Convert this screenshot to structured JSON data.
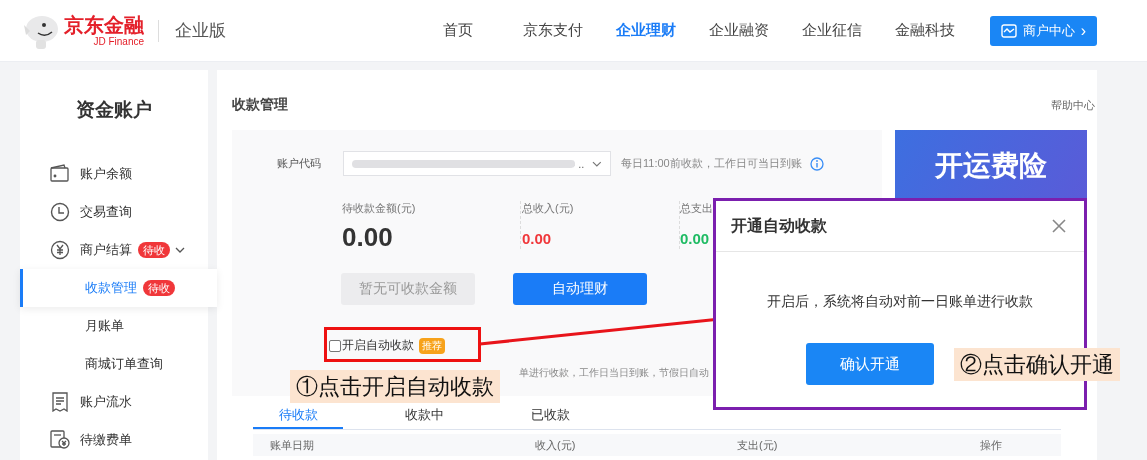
{
  "header": {
    "logo": {
      "name": "京东金融",
      "subtitle": "JD Finance"
    },
    "edition": "企业版",
    "nav": [
      {
        "label": "首页",
        "selected": false
      },
      {
        "label": "京东支付",
        "selected": false
      },
      {
        "label": "企业理财",
        "selected": true
      },
      {
        "label": "企业融资",
        "selected": false
      },
      {
        "label": "企业征信",
        "selected": false
      },
      {
        "label": "金融科技",
        "selected": false
      }
    ],
    "merchant_button": {
      "label": "商户中心",
      "arrow": "›"
    }
  },
  "sidebar": {
    "title": "资金账户",
    "items": [
      {
        "label": "账户余额",
        "kind": "wallet",
        "selected": false
      },
      {
        "label": "交易查询",
        "kind": "clock",
        "selected": false
      },
      {
        "label": "商户结算",
        "kind": "yen",
        "badge": "待收",
        "expanded": true,
        "selected": false,
        "children": [
          {
            "label": "收款管理",
            "badge": "待收",
            "selected": true
          },
          {
            "label": "月账单",
            "selected": false
          },
          {
            "label": "商城订单查询",
            "selected": false
          }
        ]
      },
      {
        "label": "账户流水",
        "kind": "receipt",
        "selected": false
      },
      {
        "label": "待缴费单",
        "kind": "bill",
        "selected": false
      }
    ]
  },
  "content": {
    "title": "收款管理",
    "help_link": "帮助中心",
    "account": {
      "label": "账户代码",
      "value": "..",
      "hint": "每日11:00前收款，工作日可当日到账"
    },
    "stats": [
      {
        "label": "待收款金额(元)",
        "value": "0.00",
        "kind": "pending"
      },
      {
        "label": "总收入(元)",
        "value": "0.00",
        "kind": "income"
      },
      {
        "label": "总支出",
        "value": "0.00",
        "kind": "expense"
      }
    ],
    "buttons": [
      {
        "label": "暂无可收款金额",
        "disabled": true
      },
      {
        "label": "自动理财",
        "disabled": false
      }
    ],
    "auto_collect": {
      "label": "开启自动收款",
      "checked": false,
      "badge": "推荐"
    },
    "auto_hint": "单进行收款，工作日当日到账，节假日自动",
    "banner": {
      "text": "开运费险"
    },
    "tabs": [
      {
        "label": "待收款",
        "selected": true
      },
      {
        "label": "收款中",
        "selected": false
      },
      {
        "label": "已收款",
        "selected": false
      }
    ],
    "table": {
      "columns": [
        "账单日期",
        "收入(元)",
        "支出(元)",
        "操作"
      ]
    }
  },
  "dialog": {
    "title": "开通自动收款",
    "body": "开启后，系统将自动对前一日账单进行收款",
    "confirm": "确认开通"
  },
  "annotations": [
    {
      "text": "①点击开启自动收款"
    },
    {
      "text": "②点击确认开通"
    }
  ]
}
